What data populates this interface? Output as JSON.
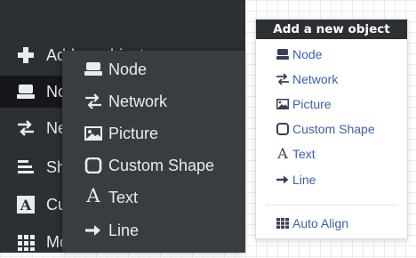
{
  "sidebar": {
    "items": [
      {
        "icon": "plus-icon",
        "label": "Add an object"
      },
      {
        "icon": "node-icon",
        "label": "Node"
      },
      {
        "icon": "network-icon",
        "label": "Network"
      },
      {
        "icon": "shape-icon",
        "label": "Shape"
      },
      {
        "icon": "text-icon",
        "label": "Custom"
      },
      {
        "icon": "grid-icon",
        "label": "More"
      }
    ],
    "active_index": 1
  },
  "flyout": {
    "items": [
      {
        "icon": "node-icon",
        "label": "Node"
      },
      {
        "icon": "network-icon",
        "label": "Network"
      },
      {
        "icon": "picture-icon",
        "label": "Picture"
      },
      {
        "icon": "custom-shape-icon",
        "label": "Custom Shape"
      },
      {
        "icon": "text-icon",
        "label": "Text"
      },
      {
        "icon": "line-icon",
        "label": "Line"
      }
    ]
  },
  "panel": {
    "title": "Add a new object",
    "items": [
      {
        "icon": "node-icon",
        "label": "Node"
      },
      {
        "icon": "network-icon",
        "label": "Network"
      },
      {
        "icon": "picture-icon",
        "label": "Picture"
      },
      {
        "icon": "custom-shape-icon",
        "label": "Custom Shape"
      },
      {
        "icon": "text-icon",
        "label": "Text"
      },
      {
        "icon": "line-icon",
        "label": "Line"
      }
    ],
    "auto_align": {
      "icon": "grid-icon",
      "label": "Auto Align"
    }
  },
  "colors": {
    "sidebar_bg": "#2c3035",
    "flyout_bg": "#383d42",
    "active_bg": "#15171a",
    "link_blue": "#3b60a8",
    "icon_navy": "#3a3f58"
  }
}
